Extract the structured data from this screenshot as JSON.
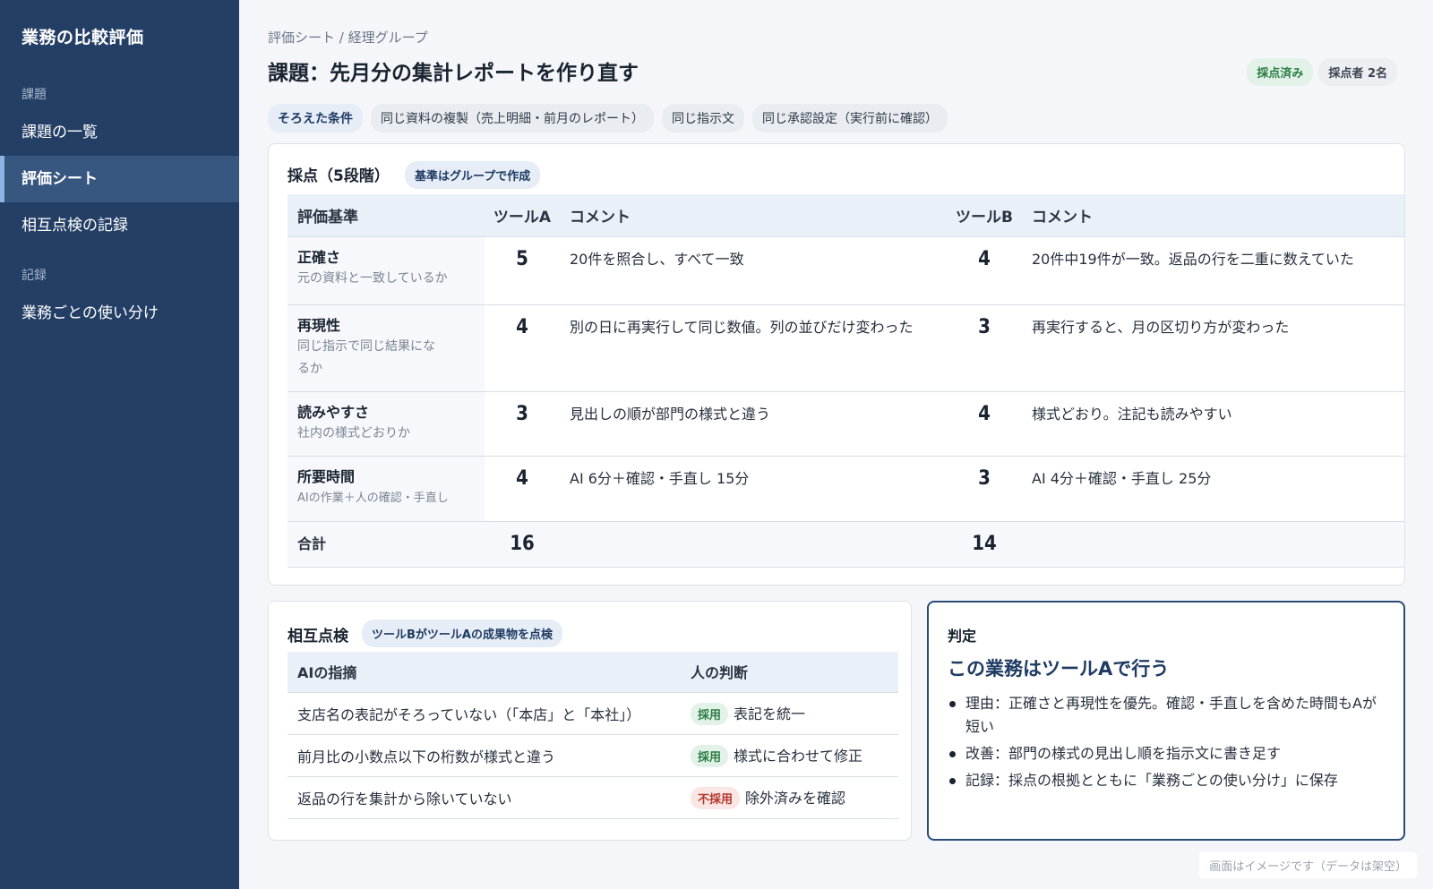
{
  "sidebar": {
    "app_title": "業務の比較評価",
    "section_tasks": "課題",
    "section_records": "記録",
    "items": [
      {
        "label": "課題の一覧"
      },
      {
        "label": "評価シート"
      },
      {
        "label": "相互点検の記録"
      },
      {
        "label": "業務ごとの使い分け"
      }
    ]
  },
  "header": {
    "breadcrumb": "評価シート / 経理グループ",
    "title": "課題：先月分の集計レポートを作り直す",
    "badge_scored": "採点済み",
    "badge_graders": "採点者 2名"
  },
  "conditions": {
    "label": "そろえた条件",
    "items": [
      "同じ資料の複製（売上明細・前月のレポート）",
      "同じ指示文",
      "同じ承認設定（実行前に確認）"
    ]
  },
  "scoring": {
    "title": "採点（5段階）",
    "note": "基準はグループで作成",
    "headers": {
      "criterion": "評価基準",
      "tool_a": "ツールA",
      "comment_a": "コメント",
      "tool_b": "ツールB",
      "comment_b": "コメント"
    },
    "rows": [
      {
        "name": "正確さ",
        "sub": "元の資料と一致しているか",
        "score_a": "5",
        "comment_a": "20件を照合し、すべて一致",
        "score_b": "4",
        "comment_b": "20件中19件が一致。返品の行を二重に数えていた"
      },
      {
        "name": "再現性",
        "sub": "同じ指示で同じ結果になるか",
        "score_a": "4",
        "comment_a": "別の日に再実行して同じ数値。列の並びだけ変わった",
        "score_b": "3",
        "comment_b": "再実行すると、月の区切り方が変わった"
      },
      {
        "name": "読みやすさ",
        "sub": "社内の様式どおりか",
        "score_a": "3",
        "comment_a": "見出しの順が部門の様式と違う",
        "score_b": "4",
        "comment_b": "様式どおり。注記も読みやすい"
      },
      {
        "name": "所要時間",
        "sub": "AIの作業＋人の確認・手直し",
        "score_a": "4",
        "comment_a": "AI 6分＋確認・手直し 15分",
        "score_b": "3",
        "comment_b": "AI 4分＋確認・手直し 25分"
      }
    ],
    "total_label": "合計",
    "total_a": "16",
    "total_b": "14"
  },
  "cross_check": {
    "title": "相互点検",
    "note": "ツールBがツールAの成果物を点検",
    "headers": {
      "finding": "AIの指摘",
      "judgment": "人の判断"
    },
    "rows": [
      {
        "finding": "支店名の表記がそろっていない（「本店」と「本社」）",
        "tag": "採用",
        "tag_type": "ok",
        "action": "表記を統一"
      },
      {
        "finding": "前月比の小数点以下の桁数が様式と違う",
        "tag": "採用",
        "tag_type": "ok",
        "action": "様式に合わせて修正"
      },
      {
        "finding": "返品の行を集計から除いていない",
        "tag": "不採用",
        "tag_type": "ng",
        "action": "除外済みを確認"
      }
    ]
  },
  "verdict": {
    "label": "判定",
    "headline": "この業務はツールAで行う",
    "points": [
      "理由：正確さと再現性を優先。確認・手直しを含めた時間もAが短い",
      "改善：部門の様式の見出し順を指示文に書き足す",
      "記録：採点の根拠とともに「業務ごとの使い分け」に保存"
    ]
  },
  "footnote": "画面はイメージです（データは架空）"
}
